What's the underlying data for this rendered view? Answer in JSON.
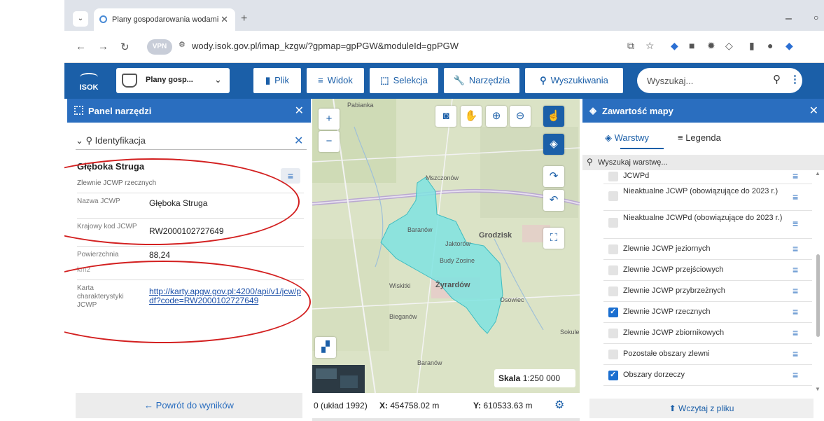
{
  "browser": {
    "tab_title": "Plany gospodarowania wodami",
    "url": "wody.isok.gov.pl/imap_kzgw/?gpmap=gpPGW&moduleId=gpPGW",
    "vpn_label": "VPN"
  },
  "app": {
    "logo_text": "ISOK",
    "project_label": "Plany gosp...",
    "toolbar": [
      {
        "label": "Plik",
        "icon": "file-icon"
      },
      {
        "label": "Widok",
        "icon": "list-icon"
      },
      {
        "label": "Selekcja",
        "icon": "selection-icon"
      },
      {
        "label": "Narzędzia",
        "icon": "wrench-icon"
      },
      {
        "label": "Wyszukiwania",
        "icon": "search-icon"
      }
    ],
    "search_placeholder": "Wyszukaj..."
  },
  "left_panel": {
    "title": "Panel narzędzi",
    "section": "Identyfikacja",
    "feature_title": "Głęboka Struga",
    "feature_subtitle": "Zlewnie JCWP rzecznych",
    "attributes": [
      {
        "key": "Nazwa JCWP",
        "value": "Głęboka Struga"
      },
      {
        "key": "Krajowy kod JCWP",
        "value": "RW2000102727649"
      },
      {
        "key": "Powierzchnia",
        "value": "88,24"
      },
      {
        "key": "Karta charakterystyki JCWP",
        "value": "http://karty.apgw.gov.pl:4200/api/v1/jcw/pdf?code=RW2000102727649"
      }
    ],
    "unit": "km2",
    "back_label": "Powrót do wyników"
  },
  "map": {
    "scale_label": "Skala",
    "scale_value": "1:250 000",
    "coord_system": "0 (układ 1992)",
    "x_label": "X:",
    "x_value": "454758.02 m",
    "y_label": "Y:",
    "y_value": "610533.63 m",
    "place_labels": [
      "Żyrardów",
      "Grodzisk",
      "Baranów",
      "Mszczonów",
      "Wiskitki",
      "Jaktorów",
      "Osowiec",
      "Budy Zosine",
      "Bieganów",
      "Sokule"
    ]
  },
  "right_panel": {
    "title": "Zawartość mapy",
    "tab_layers": "Warstwy",
    "tab_legend": "Legenda",
    "layer_search_placeholder": "Wyszukaj warstwę...",
    "layers": [
      {
        "name": "JCWPd",
        "checked": false
      },
      {
        "name": "Nieaktualne JCWP (obowiązujące do 2023 r.)",
        "checked": false
      },
      {
        "name": "Nieaktualne JCWPd (obowiązujące do 2023 r.)",
        "checked": false
      },
      {
        "name": "Zlewnie JCWP jeziornych",
        "checked": false
      },
      {
        "name": "Zlewnie JCWP przejściowych",
        "checked": false
      },
      {
        "name": "Zlewnie JCWP przybrzeżnych",
        "checked": false
      },
      {
        "name": "Zlewnie JCWP rzecznych",
        "checked": true
      },
      {
        "name": "Zlewnie JCWP zbiornikowych",
        "checked": false
      },
      {
        "name": "Pozostałe obszary zlewni",
        "checked": false
      },
      {
        "name": "Obszary dorzeczy",
        "checked": true
      }
    ],
    "load_label": "Wczytaj z pliku"
  }
}
